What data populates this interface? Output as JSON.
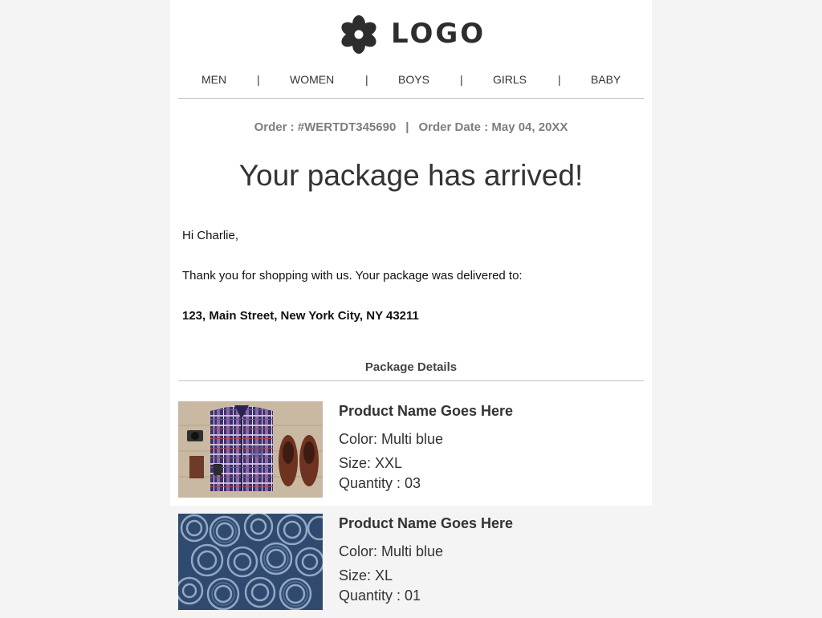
{
  "logo": {
    "text": "LOGO",
    "icon": "flower-icon"
  },
  "nav": {
    "items": [
      "MEN",
      "WOMEN",
      "BOYS",
      "GIRLS",
      "BABY"
    ],
    "separator": "|"
  },
  "order": {
    "number_label": "Order : #WERTDT345690",
    "separator": "|",
    "date_label": "Order Date : May 04, 20XX"
  },
  "headline": "Your package has arrived!",
  "greeting": "Hi Charlie,",
  "message": "Thank you for shopping with us. Your package was delivered to:",
  "address": "123, Main Street, New York City, NY 43211",
  "package_details_title": "Package Details",
  "products": [
    {
      "name": "Product Name Goes Here",
      "color": "Color: Multi blue",
      "size": "Size: XXL",
      "quantity": "Quantity : 03",
      "image": "flatlay-shirt-shoes-photo"
    },
    {
      "name": "Product Name Goes Here",
      "color": "Color: Multi blue",
      "size": "Size: XL",
      "quantity": "Quantity : 01",
      "image": "rolled-jeans-photo"
    }
  ],
  "colors": {
    "page_bg": "#f4f4f4",
    "card_bg": "#ffffff",
    "text": "#333333",
    "muted": "#7d7d7d",
    "divider": "#c2c2c2"
  }
}
